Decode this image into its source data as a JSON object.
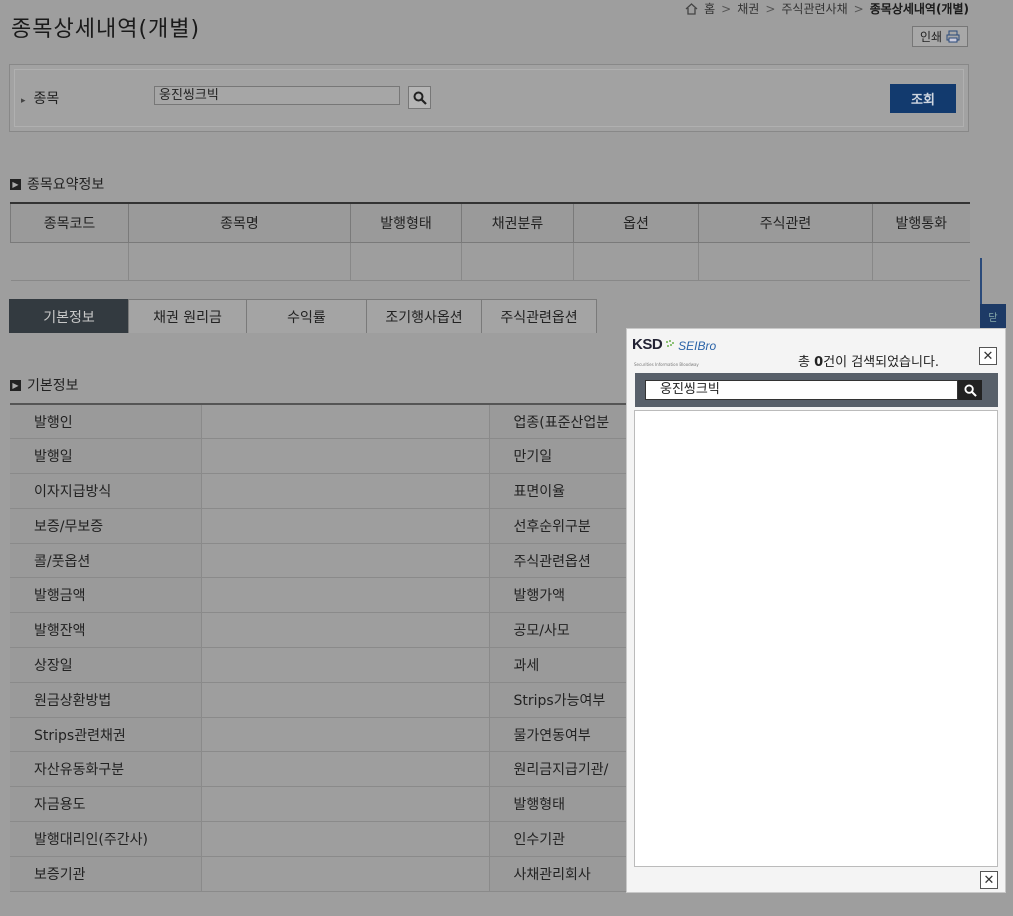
{
  "page": {
    "title": "종목상세내역(개별)",
    "breadcrumb": [
      "홈",
      "채권",
      "주식관련사채",
      "종목상세내역(개별)"
    ],
    "print_label": "인쇄"
  },
  "search": {
    "label": "종목",
    "value": "웅진씽크빅",
    "query_button": "조회"
  },
  "summary": {
    "title": "종목요약정보",
    "columns": [
      "종목코드",
      "종목명",
      "발행형태",
      "채권분류",
      "옵션",
      "주식관련",
      "발행통화"
    ]
  },
  "tabs": [
    "기본정보",
    "채권 원리금",
    "수익률",
    "조기행사옵션",
    "주식관련옵션"
  ],
  "basic_info": {
    "title": "기본정보",
    "rows": [
      [
        "발행인",
        "업종(표준산업분"
      ],
      [
        "발행일",
        "만기일"
      ],
      [
        "이자지급방식",
        "표면이율"
      ],
      [
        "보증/무보증",
        "선후순위구분"
      ],
      [
        "콜/풋옵션",
        "주식관련옵션"
      ],
      [
        "발행금액",
        "발행가액"
      ],
      [
        "발행잔액",
        "공모/사모"
      ],
      [
        "상장일",
        "과세"
      ],
      [
        "원금상환방법",
        "Strips가능여부"
      ],
      [
        "Strips관련채권",
        "물가연동여부"
      ],
      [
        "자산유동화구분",
        "원리금지급기관/"
      ],
      [
        "자금용도",
        "발행형태"
      ],
      [
        "발행대리인(주간사)",
        "인수기관"
      ],
      [
        "보증기관",
        "사채관리회사"
      ]
    ]
  },
  "popup": {
    "logo_ksd": "KSD",
    "logo_seibro": "SEIBro",
    "logo_tagline": "Securities Information Bloodway",
    "count_prefix": "총 ",
    "count": "0",
    "count_suffix": "건이 검색되었습니다.",
    "search_value": "웅진씽크빅",
    "close_symbol": "✕"
  },
  "side_tab_label": "닫"
}
